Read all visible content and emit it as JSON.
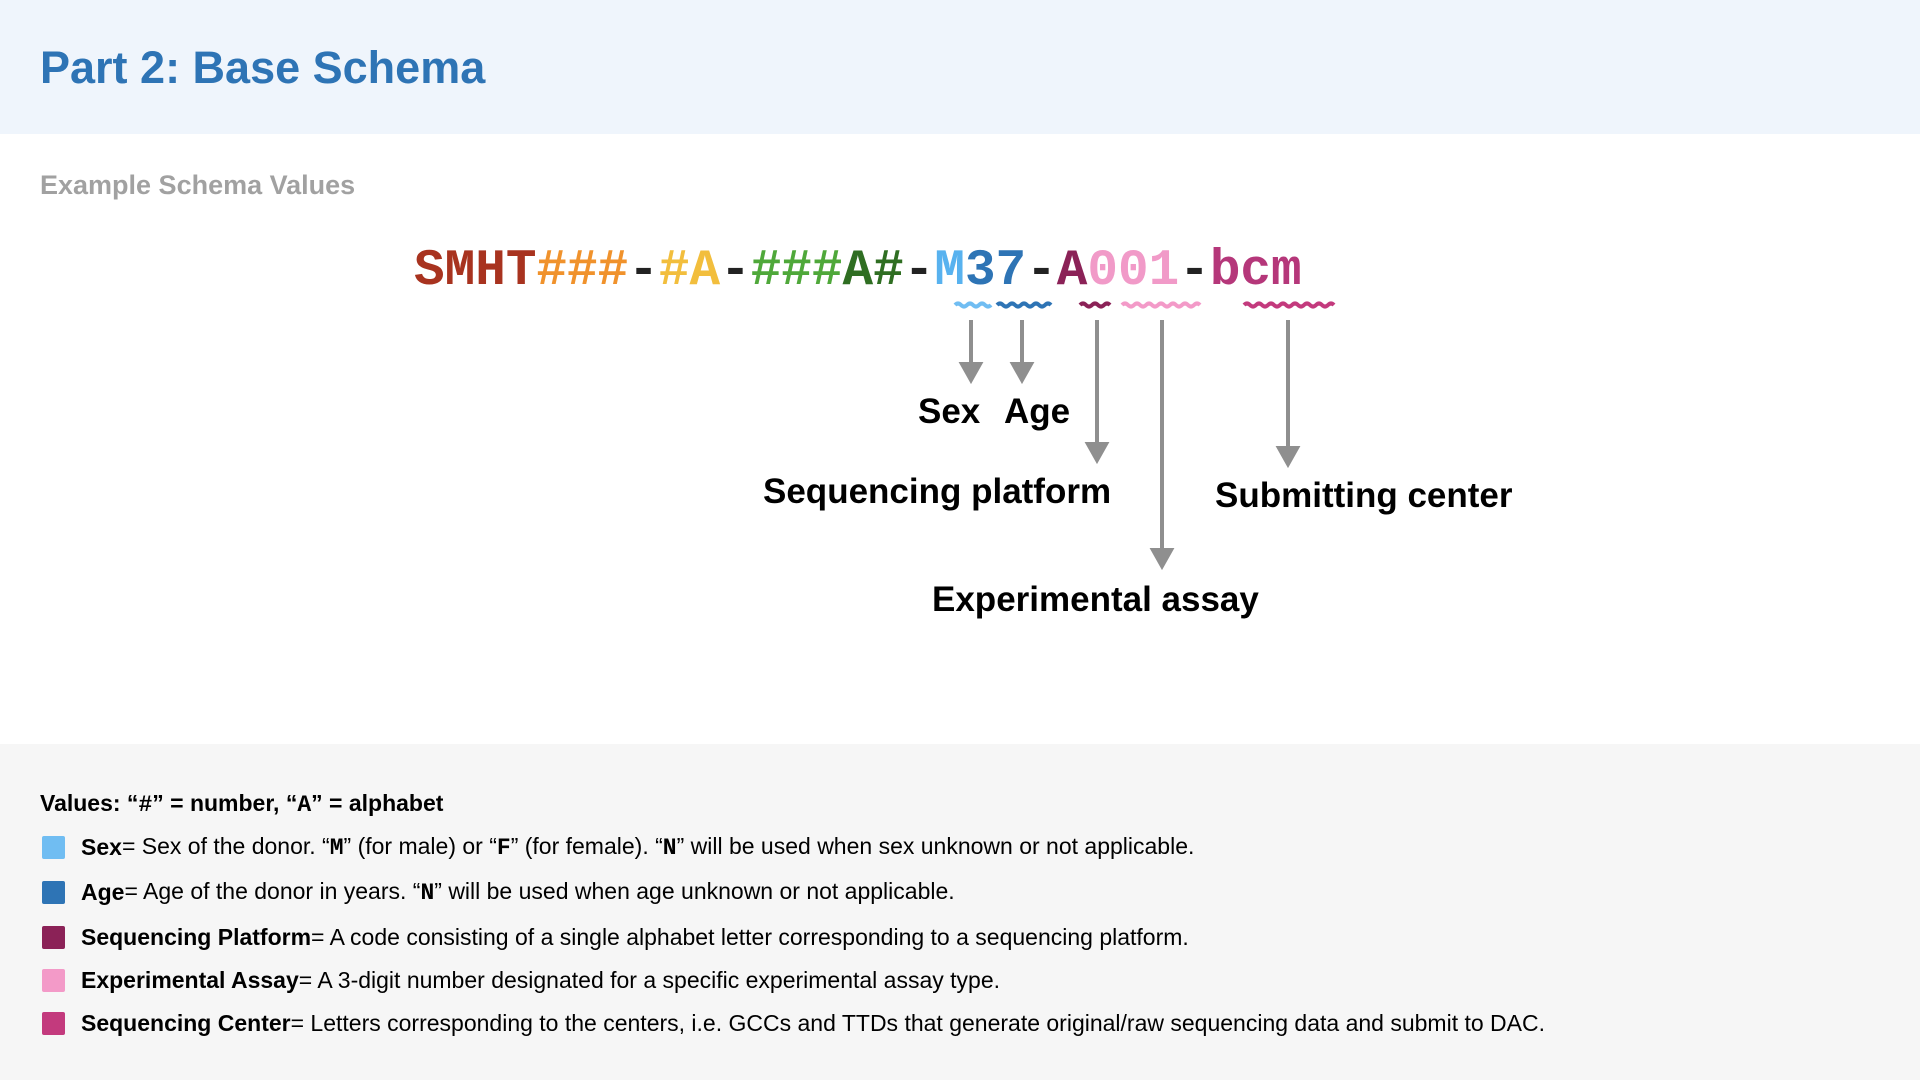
{
  "page": {
    "title": "Part 2: Base Schema",
    "subtitle": "Example Schema Values"
  },
  "schema": {
    "segments": [
      {
        "text": "SMHT",
        "color": "#a8331f"
      },
      {
        "text": "###",
        "color": "#f0922c"
      },
      {
        "text": "-",
        "color": "#222222"
      },
      {
        "text": "#A",
        "color": "#f2be3d"
      },
      {
        "text": "-",
        "color": "#222222"
      },
      {
        "text": "###",
        "color": "#4fa83a"
      },
      {
        "text": "A#",
        "color": "#2f6e22"
      },
      {
        "text": "-",
        "color": "#222222"
      },
      {
        "text": "M",
        "color": "#58b2ef"
      },
      {
        "text": "37",
        "color": "#2e74b5"
      },
      {
        "text": "-",
        "color": "#222222"
      },
      {
        "text": "A",
        "color": "#8b2257"
      },
      {
        "text": "001",
        "color": "#f19ac8"
      },
      {
        "text": "-",
        "color": "#222222"
      },
      {
        "text": "bcm",
        "color": "#b5377a"
      }
    ]
  },
  "callouts": {
    "sex": "Sex",
    "age": "Age",
    "sequencing_platform": "Sequencing platform",
    "submitting_center": "Submitting center",
    "experimental_assay": "Experimental assay"
  },
  "legend": {
    "heading_prefix": "Values: “",
    "heading_number_symbol": "#",
    "heading_middle": "” = number, “",
    "heading_alphabet_symbol": "A",
    "heading_suffix": "” = alphabet",
    "items": [
      {
        "color": "#70bdf2",
        "term": "Sex",
        "parts": [
          " = Sex of the donor. “",
          {
            "code": "M"
          },
          "” (for male) or “",
          {
            "code": "F"
          },
          "” (for female). “",
          {
            "code": "N"
          },
          "” will be used when sex unknown or not applicable."
        ]
      },
      {
        "color": "#2e74b5",
        "term": "Age",
        "parts": [
          " = Age of the donor in years. “",
          {
            "code": "N"
          },
          "” will be used when age unknown or not applicable."
        ]
      },
      {
        "color": "#8b2257",
        "term": "Sequencing Platform",
        "parts": [
          " = A code consisting of a single alphabet letter corresponding to a sequencing platform."
        ]
      },
      {
        "color": "#f39ac8",
        "term": "Experimental Assay",
        "parts": [
          " = A 3-digit number designated for a specific experimental assay type."
        ]
      },
      {
        "color": "#c33a7d",
        "term": "Sequencing Center",
        "parts": [
          " = Letters corresponding to the centers, i.e. GCCs and TTDs that generate original/raw sequencing data and submit to DAC."
        ]
      }
    ]
  }
}
